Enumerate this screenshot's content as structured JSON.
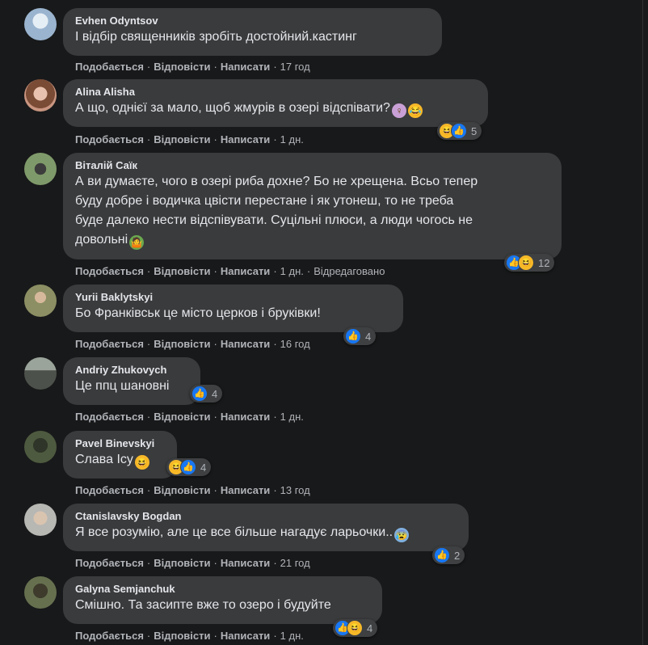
{
  "actions": {
    "like": "Подобається",
    "reply": "Відповісти",
    "write": "Написати",
    "sep": "·"
  },
  "icons": {
    "like": "thumbs-up-icon",
    "haha": "laughing-face-icon"
  },
  "colors": {
    "background": "#18191a",
    "bubble": "#3a3b3c",
    "text": "#e4e6eb",
    "muted": "#b0b3b8",
    "like_blue": "#1877f2",
    "haha_yellow": "#f7b928"
  },
  "comments": [
    {
      "author": "Evhen Odyntsov",
      "lines": [
        "І відбір священників зробіть достойний.кастинг"
      ],
      "time": "17 год",
      "avatar_color": "#9ab4cf"
    },
    {
      "author": "Alina Alisha",
      "lines": [
        "А що, однієї за мало, щоб жмурів в озері відспівати?"
      ],
      "time": "1 дн.",
      "reactions_count": "5",
      "avatar_color": "#c99580"
    },
    {
      "author": "Віталій Саїк",
      "lines": [
        "А ви думаєте, чого в озері риба дохне? Бо не хрещена. Всьо тепер",
        "буду добре і водичка цвісти перестане і як утонеш, то не треба",
        "буде далеко нести відспівувати. Суцільні плюси, а люди чогось не",
        "довольні"
      ],
      "time": "1 дн.",
      "edited": "Відредаговано",
      "reactions_count": "12",
      "avatar_color": "#7f9a6a"
    },
    {
      "author": "Yurii Baklytskyi",
      "lines": [
        "Бо Франківськ це місто церков і бруківки!"
      ],
      "time": "16 год",
      "reactions_count": "4",
      "avatar_color": "#8c8f63"
    },
    {
      "author": "Andriy Zhukovych",
      "lines": [
        "Це ппц шановні"
      ],
      "time": "1 дн.",
      "reactions_count": "4",
      "avatar_color": "#6b6f69"
    },
    {
      "author": "Pavel Binevskyi",
      "lines": [
        "Слава Ісу"
      ],
      "time": "13 год",
      "reactions_count": "4",
      "avatar_color": "#4e5a3f"
    },
    {
      "author": "Ctanislavsky Bogdan",
      "lines": [
        "Я все розумію, але це все більше нагадує ларьочки.."
      ],
      "time": "21 год",
      "reactions_count": "2",
      "avatar_color": "#b7b7b4"
    },
    {
      "author": "Galyna Semjanchuk",
      "lines": [
        "Смішно. Та засипте вже то озеро і будуйте"
      ],
      "time": "1 дн.",
      "reactions_count": "4",
      "avatar_color": "#66704f"
    }
  ]
}
